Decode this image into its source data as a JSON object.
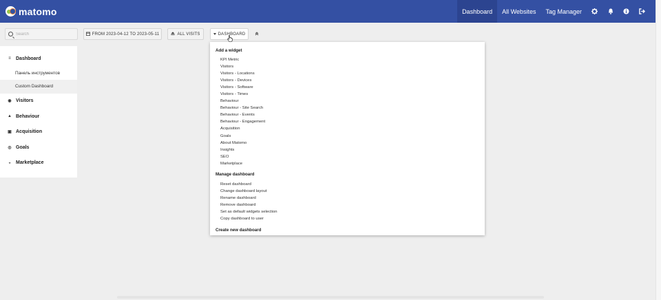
{
  "app": {
    "logo_text": "matomo"
  },
  "topnav": {
    "items": [
      {
        "label": "Dashboard",
        "active": true
      },
      {
        "label": "All Websites",
        "active": false
      },
      {
        "label": "Tag Manager",
        "active": false
      }
    ],
    "icons": [
      "gear-icon",
      "bell-icon",
      "help-icon",
      "logout-icon"
    ]
  },
  "search": {
    "placeholder": "Search"
  },
  "toolbar": {
    "date_label": "FROM 2023-04-12 TO 2023-05-11",
    "segment_label": "ALL VISITS",
    "dashboard_label": "DASHBOARD",
    "collapse_glyph": "»"
  },
  "sidebar": {
    "items": [
      {
        "label": "Dashboard",
        "icon": "menu-icon",
        "glyph": "≡"
      },
      {
        "label": "Visitors",
        "icon": "eye-icon",
        "glyph": "◉"
      },
      {
        "label": "Behaviour",
        "icon": "bell-icon",
        "glyph": "▲"
      },
      {
        "label": "Acquisition",
        "icon": "window-icon",
        "glyph": "▣"
      },
      {
        "label": "Goals",
        "icon": "target-icon",
        "glyph": "◎"
      },
      {
        "label": "Marketplace",
        "icon": "headphones-icon",
        "glyph": "◒"
      }
    ],
    "subitems": [
      {
        "label": "Панель инструментов",
        "active": false
      },
      {
        "label": "Custom Dashboard",
        "active": true
      }
    ]
  },
  "dropdown": {
    "add_widget_heading": "Add a widget",
    "widgets": [
      "KPI Metric",
      "Visitors",
      "Visitors - Locations",
      "Visitors - Devices",
      "Visitors - Software",
      "Visitors - Times",
      "Behaviour",
      "Behaviour - Site Search",
      "Behaviour - Events",
      "Behaviour - Engagement",
      "Acquisition",
      "Goals",
      "About Matomo",
      "Insights",
      "SEO",
      "Marketplace"
    ],
    "manage_heading": "Manage dashboard",
    "manage_items": [
      "Reset dashboard",
      "Change dashboard layout",
      "Rename dashboard",
      "Remove dashboard",
      "Set as default widgets selection",
      "Copy dashboard to user"
    ],
    "create_heading": "Create new dashboard"
  },
  "colors": {
    "topbar": "#3450a3",
    "topbar_active": "#2c4490",
    "background": "#eeeeee"
  }
}
